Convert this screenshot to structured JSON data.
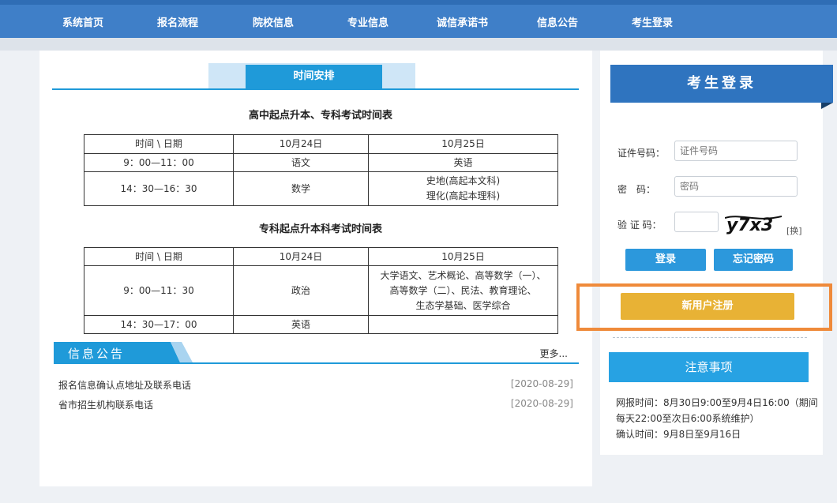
{
  "nav": {
    "items": [
      "系统首页",
      "报名流程",
      "院校信息",
      "专业信息",
      "诚信承诺书",
      "信息公告",
      "考生登录"
    ]
  },
  "schedule": {
    "tab_label": "时间安排",
    "table1": {
      "title": "高中起点升本、专科考试时间表",
      "headers": [
        "时间 \\ 日期",
        "10月24日",
        "10月25日"
      ],
      "rows": [
        [
          "9：00—11：00",
          "语文",
          "英语"
        ],
        [
          "14：30—16：30",
          "数学",
          "史地(高起本文科)\n理化(高起本理科)"
        ]
      ]
    },
    "table2": {
      "title": "专科起点升本科考试时间表",
      "headers": [
        "时间 \\ 日期",
        "10月24日",
        "10月25日"
      ],
      "rows": [
        [
          "9：00—11：30",
          "政治",
          "大学语文、艺术概论、高等数学（一）、\n高等数学（二）、民法、教育理论、\n生态学基础、医学综合"
        ],
        [
          "14：30—17：00",
          "英语",
          ""
        ]
      ]
    }
  },
  "notice": {
    "title": "信息公告",
    "more": "更多...",
    "items": [
      {
        "text": "报名信息确认点地址及联系电话",
        "date": "[2020-08-29]"
      },
      {
        "text": "省市招生机构联系电话",
        "date": "[2020-08-29]"
      }
    ]
  },
  "login": {
    "title": "考生登录",
    "id_label": "证件号码：",
    "id_placeholder": "证件号码",
    "password_label": "密　码：",
    "password_placeholder": "密码",
    "captcha_label": "验 证 码：",
    "captcha_text": "y7x3",
    "captcha_refresh": "[换]",
    "login_button": "登录",
    "forgot_button": "忘记密码",
    "register_button": "新用户注册"
  },
  "notes": {
    "title": "注意事项",
    "lines": [
      "网报时间：8月30日9:00至9月4日16:00（期间每天22:00至次日6:00系统维护）",
      "确认时间：9月8日至9月16日"
    ]
  },
  "colors": {
    "nav_bg": "#3f7fc8",
    "accent_blue": "#1f9ad9",
    "register_yellow": "#e8b235",
    "highlight_orange": "#ef8a3a"
  }
}
